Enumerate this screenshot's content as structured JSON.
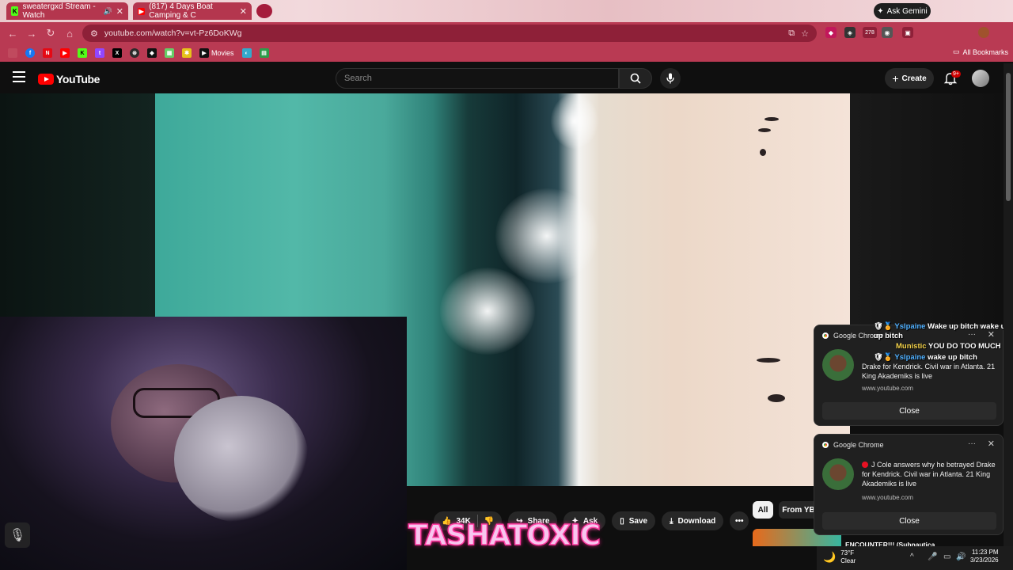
{
  "tabs": [
    {
      "title": "sweatergxd Stream - Watch",
      "favicon": "K"
    },
    {
      "title": "(817) 4 Days Boat Camping & C",
      "favicon": "yt"
    }
  ],
  "gemini_label": "Ask Gemini",
  "address": {
    "url": "youtube.com/watch?v=vt-Pz6DoKWg"
  },
  "bookmarks": {
    "movies_label": "Movies",
    "all_label": "All Bookmarks"
  },
  "extensions": {
    "badge": "278"
  },
  "youtube": {
    "logo": "YouTube",
    "search_placeholder": "Search",
    "create_label": "Create",
    "notif_count": "9+"
  },
  "actions": {
    "likes": "34K",
    "share": "Share",
    "ask": "Ask",
    "save": "Save",
    "download": "Download",
    "more": "•••"
  },
  "chips": {
    "all": "All",
    "from": "From YB"
  },
  "related": {
    "title": "ENCOUNTER!!! (Subnautica"
  },
  "overlay_text": "TASHATOXIC",
  "chat": [
    {
      "user": "Yslpaine",
      "message": "Wake up bitch wake up up bitch"
    },
    {
      "user": "Munistic",
      "message": "YOU DO TOO MUCH"
    },
    {
      "user": "Yslpaine",
      "message": "wake up bitch"
    }
  ],
  "notifications": [
    {
      "app": "Google Chrome",
      "text": "Drake for Kendrick. Civil war in Atlanta. 21 King Akademiks is live",
      "source": "www.youtube.com",
      "button": "Close"
    },
    {
      "app": "Google Chrome",
      "text": "J Cole answers why he betrayed Drake for Kendrick. Civil war in Atlanta. 21 King Akademiks is live",
      "source": "www.youtube.com",
      "button": "Close"
    }
  ],
  "taskbar": {
    "temp": "73°F",
    "condition": "Clear",
    "time": "11:23 PM",
    "date": "3/23/2026"
  },
  "colors": {
    "chrome_accent": "#b93a53",
    "yt_red": "#ff0000",
    "overlay_pink": "#ff3aa0"
  }
}
